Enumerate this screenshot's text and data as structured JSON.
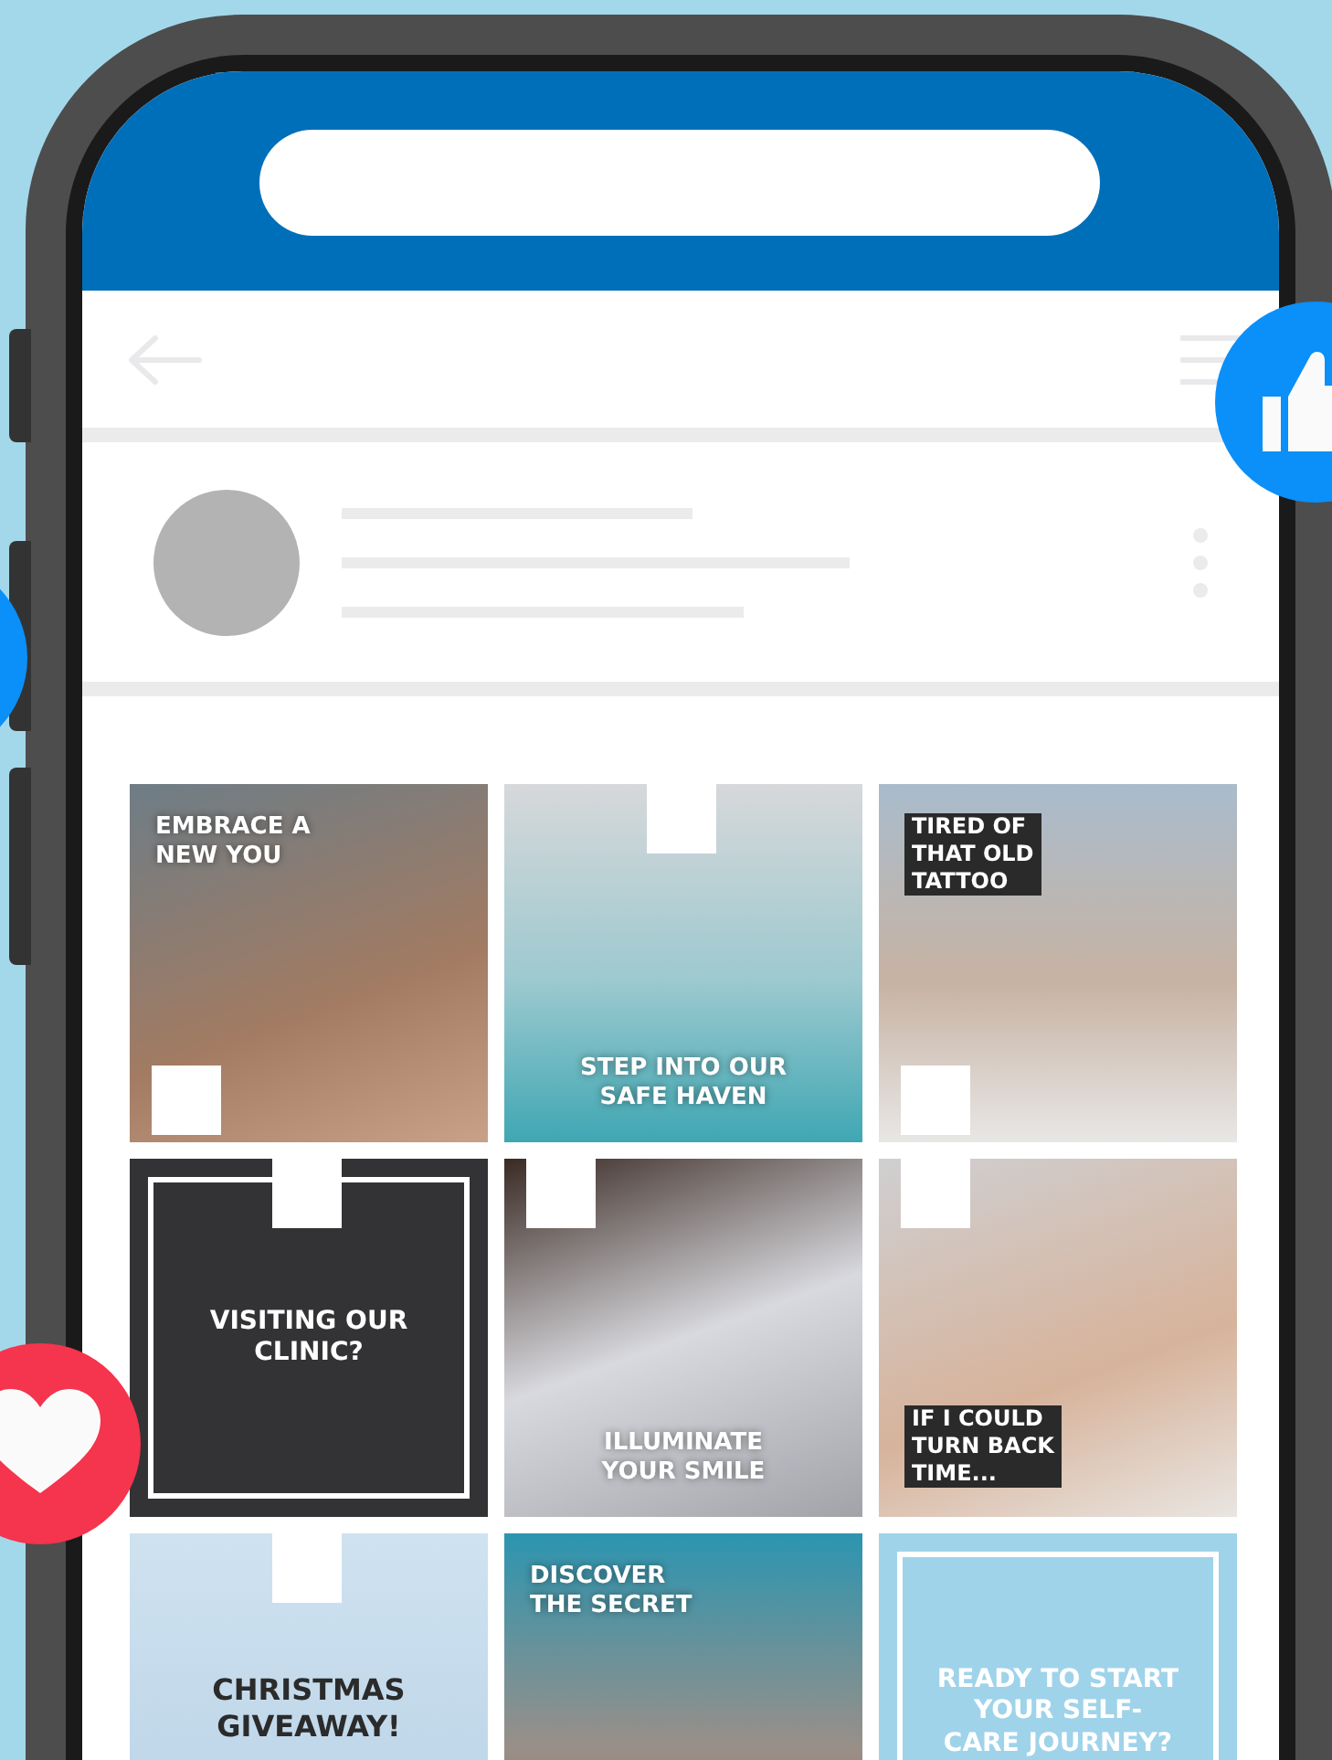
{
  "feed": {
    "tiles": [
      {
        "kind": "photo",
        "headline": "EMBRACE A\nNEW YOU"
      },
      {
        "kind": "photo",
        "headline": "STEP INTO OUR\nSAFE HAVEN"
      },
      {
        "kind": "photo",
        "headline": "TIRED OF\nTHAT OLD\nTATTOO"
      },
      {
        "kind": "dark-panel",
        "headline": "VISITING OUR\nCLINIC?"
      },
      {
        "kind": "photo",
        "headline": "ILLUMINATE\nYOUR SMILE"
      },
      {
        "kind": "photo",
        "headline": "IF I COULD\nTURN BACK\nTIME..."
      },
      {
        "kind": "photo",
        "headline": "CHRISTMAS\nGIVEAWAY!"
      },
      {
        "kind": "photo",
        "headline": "DISCOVER\nTHE SECRET"
      },
      {
        "kind": "light-panel",
        "headline": "READY TO START\nYOUR SELF-\nCARE JOURNEY?"
      }
    ]
  },
  "reactions": [
    {
      "kind": "like"
    },
    {
      "kind": "like"
    },
    {
      "kind": "love"
    }
  ]
}
